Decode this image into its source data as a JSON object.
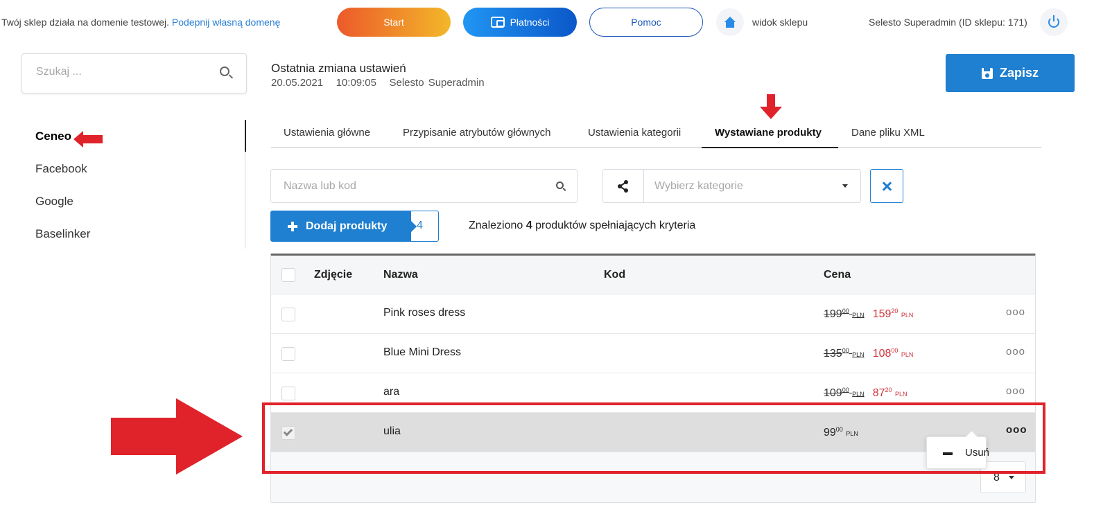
{
  "topbar": {
    "notice_text": "Twój sklep działa na domenie testowej.",
    "notice_link": "Podepnij własną domenę",
    "start_label": "Start",
    "payments_label": "Płatności",
    "help_label": "Pomoc",
    "shop_view_label": "widok sklepu",
    "user_label": "Selesto Superadmin (ID sklepu: 171)",
    "start_gradient": [
      "#ec5a2a",
      "#f3b72a"
    ],
    "payments_gradient": [
      "#2196f3",
      "#0b57c9"
    ]
  },
  "sidebar": {
    "search_placeholder": "Szukaj ...",
    "items": [
      {
        "label": "Ceneo",
        "active": true
      },
      {
        "label": "Facebook",
        "active": false
      },
      {
        "label": "Google",
        "active": false
      },
      {
        "label": "Baselinker",
        "active": false
      }
    ]
  },
  "header": {
    "change_title": "Ostatnia zmiana ustawień",
    "change_date": "20.05.2021",
    "change_time": "10:09:05",
    "change_user": "Selesto Superadmin",
    "save_label": "Zapisz",
    "accent_color": "#1f7fd0"
  },
  "tabs": [
    {
      "label": "Ustawienia główne",
      "active": false
    },
    {
      "label": "Przypisanie atrybutów głównych",
      "active": false
    },
    {
      "label": "Ustawienia kategorii",
      "active": false
    },
    {
      "label": "Wystawiane produkty",
      "active": true
    },
    {
      "label": "Dane pliku XML",
      "active": false
    }
  ],
  "filters": {
    "name_placeholder": "Nazwa lub kod",
    "category_placeholder": "Wybierz kategorie"
  },
  "actions": {
    "add_label": "Dodaj produkty",
    "add_count": "4",
    "found_prefix": "Znaleziono",
    "found_count": "4",
    "found_suffix": "produktów spełniających kryteria"
  },
  "table": {
    "columns": [
      "Zdjęcie",
      "Nazwa",
      "Kod",
      "Cena"
    ],
    "rows": [
      {
        "name": "Pink roses dress",
        "old_int": "199",
        "old_dec": "00",
        "new_int": "159",
        "new_dec": "20",
        "currency": "PLN",
        "selected": false,
        "discounted": true
      },
      {
        "name": "Blue Mini Dress",
        "old_int": "135",
        "old_dec": "00",
        "new_int": "108",
        "new_dec": "00",
        "currency": "PLN",
        "selected": false,
        "discounted": true
      },
      {
        "name": "ara",
        "old_int": "109",
        "old_dec": "00",
        "new_int": "87",
        "new_dec": "20",
        "currency": "PLN",
        "selected": false,
        "discounted": true
      },
      {
        "name": "ulia",
        "old_int": "99",
        "old_dec": "00",
        "new_int": "",
        "new_dec": "",
        "currency": "PLN",
        "selected": true,
        "discounted": false
      }
    ],
    "row_menu_label": "Usuń",
    "per_page": "8",
    "more_icon": "ooo"
  },
  "annotation_color": "#e0222b"
}
